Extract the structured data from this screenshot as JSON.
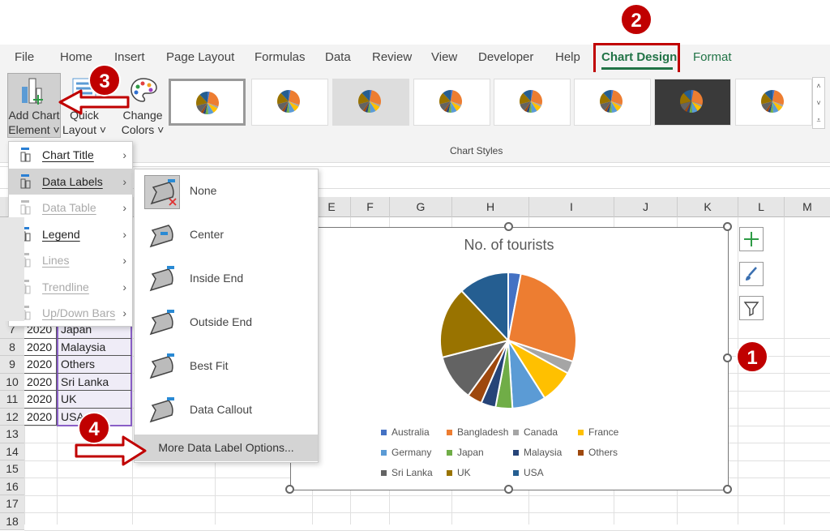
{
  "tabs": [
    {
      "label": "File"
    },
    {
      "label": "Home"
    },
    {
      "label": "Insert"
    },
    {
      "label": "Page Layout"
    },
    {
      "label": "Formulas"
    },
    {
      "label": "Data"
    },
    {
      "label": "Review"
    },
    {
      "label": "View"
    },
    {
      "label": "Developer"
    },
    {
      "label": "Help"
    },
    {
      "label": "Chart Design",
      "active": true
    },
    {
      "label": "Format"
    }
  ],
  "ribbon": {
    "add_chart_element": [
      "Add Chart",
      "Element ˅"
    ],
    "quick_layout": [
      "Quick",
      "Layout ˅"
    ],
    "change_colors": [
      "Change",
      "Colors ˅"
    ],
    "chart_styles_label": "Chart Styles"
  },
  "columns": [
    "E",
    "F",
    "G",
    "H",
    "I",
    "J",
    "K",
    "L",
    "M"
  ],
  "rows": [
    {
      "n": "7",
      "year": "2020",
      "country": "Japan"
    },
    {
      "n": "8",
      "year": "2020",
      "country": "Malaysia"
    },
    {
      "n": "9",
      "year": "2020",
      "country": "Others"
    },
    {
      "n": "10",
      "year": "2020",
      "country": "Sri Lanka"
    },
    {
      "n": "11",
      "year": "2020",
      "country": "UK"
    },
    {
      "n": "12",
      "year": "2020",
      "country": "USA"
    },
    {
      "n": "13"
    },
    {
      "n": "14"
    },
    {
      "n": "15"
    },
    {
      "n": "16"
    },
    {
      "n": "17"
    },
    {
      "n": "18"
    }
  ],
  "menu": [
    {
      "label": "Chart Title"
    },
    {
      "label": "Data Labels",
      "selected": true
    },
    {
      "label": "Data Table",
      "disabled": true
    },
    {
      "label": "Legend"
    },
    {
      "label": "Lines",
      "disabled": true
    },
    {
      "label": "Trendline",
      "disabled": true
    },
    {
      "label": "Up/Down Bars",
      "disabled": true
    }
  ],
  "submenu": [
    {
      "label": "None"
    },
    {
      "label": "Center"
    },
    {
      "label": "Inside End"
    },
    {
      "label": "Outside End"
    },
    {
      "label": "Best Fit"
    },
    {
      "label": "Data Callout"
    }
  ],
  "more_options": "More Data Label Options...",
  "badges": [
    "1",
    "2",
    "3",
    "4"
  ],
  "chart_data": {
    "type": "pie",
    "title": "No. of tourists",
    "legend_position": "bottom",
    "categories": [
      "Australia",
      "Bangladesh",
      "Canada",
      "France",
      "Germany",
      "Japan",
      "Malaysia",
      "Others",
      "Sri Lanka",
      "UK",
      "USA"
    ],
    "values": [
      3,
      27,
      3,
      8,
      8,
      4,
      3.5,
      3.5,
      11,
      17,
      12
    ],
    "colors": [
      "#4472c4",
      "#ed7d31",
      "#a5a5a5",
      "#ffc000",
      "#5b9bd5",
      "#70ad47",
      "#264478",
      "#9e480e",
      "#636363",
      "#997300",
      "#255e91"
    ]
  },
  "colors": {
    "accent_green": "#217346",
    "badge_red": "#c00000"
  }
}
